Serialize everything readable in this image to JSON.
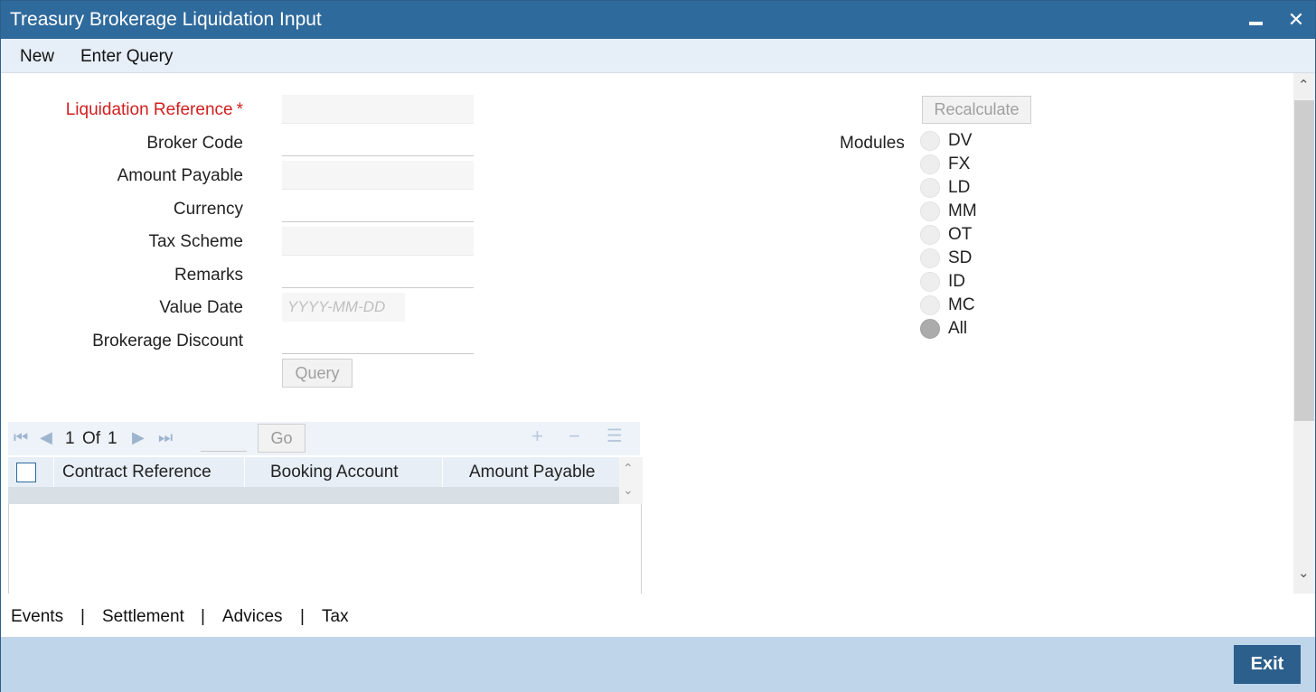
{
  "window": {
    "title": "Treasury Brokerage Liquidation Input",
    "minimize_glyph": "—",
    "close_glyph": "✕"
  },
  "menu": {
    "new_label": "New",
    "enter_query_label": "Enter Query"
  },
  "form": {
    "liquidation_reference": {
      "label": "Liquidation Reference",
      "required_mark": "*",
      "value": ""
    },
    "broker_code": {
      "label": "Broker Code",
      "value": ""
    },
    "amount_payable": {
      "label": "Amount Payable",
      "value": ""
    },
    "currency": {
      "label": "Currency",
      "value": ""
    },
    "tax_scheme": {
      "label": "Tax Scheme",
      "value": ""
    },
    "remarks": {
      "label": "Remarks",
      "value": ""
    },
    "value_date": {
      "label": "Value Date",
      "value": "",
      "placeholder": "YYYY-MM-DD"
    },
    "brokerage_discount": {
      "label": "Brokerage Discount",
      "value": ""
    },
    "query_button": "Query",
    "recalculate_button": "Recalculate"
  },
  "modules": {
    "label": "Modules",
    "options": [
      {
        "label": "DV",
        "checked": false
      },
      {
        "label": "FX",
        "checked": false
      },
      {
        "label": "LD",
        "checked": false
      },
      {
        "label": "MM",
        "checked": false
      },
      {
        "label": "OT",
        "checked": false
      },
      {
        "label": "SD",
        "checked": false
      },
      {
        "label": "ID",
        "checked": false
      },
      {
        "label": "MC",
        "checked": false
      },
      {
        "label": "All",
        "checked": true
      }
    ]
  },
  "grid": {
    "pagination": {
      "current": "1",
      "of_label": "Of",
      "total": "1",
      "go_label": "Go"
    },
    "columns": [
      "Contract Reference",
      "Booking Account",
      "Amount Payable"
    ],
    "icons": [
      "first-page-icon",
      "prev-page-icon",
      "next-page-icon",
      "last-page-icon",
      "add-row-icon",
      "delete-row-icon",
      "single-view-icon"
    ]
  },
  "footer_links": [
    "Events",
    "Settlement",
    "Advices",
    "Tax"
  ],
  "footer_separator": "|",
  "exit_label": "Exit",
  "colors": {
    "title_bar": "#2f6a9c",
    "required_label": "#d21f1f",
    "bottom_bar": "#bfd5ea",
    "exit_button": "#2c5f8c"
  }
}
